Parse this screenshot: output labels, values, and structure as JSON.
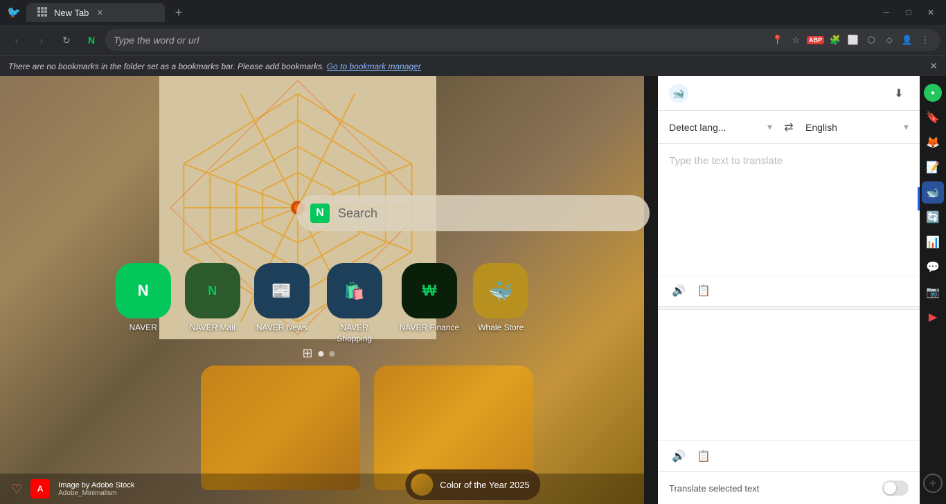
{
  "browser": {
    "title_bar": {
      "tab_label": "New Tab",
      "new_tab_icon": "+",
      "minimize": "─",
      "maximize": "□",
      "close": "✕",
      "apps_grid": "⊞"
    },
    "nav_bar": {
      "back": "‹",
      "forward": "›",
      "refresh": "↻",
      "n_icon": "N",
      "address": "Type the word or url",
      "location_icon": "⊕",
      "star_icon": "☆",
      "abp_label": "ABP",
      "extensions_icon": "⋮",
      "screenshot_icon": "⬡",
      "menu_icon": "≡",
      "profile_icon": "👤"
    },
    "bookmark_bar": {
      "message": "There are no bookmarks in the folder set as a bookmarks bar. Please add bookmarks.",
      "link_text": "Go to bookmark manager",
      "close": "✕"
    }
  },
  "new_tab": {
    "search": {
      "placeholder": "Search",
      "n_logo": "N"
    },
    "apps": [
      {
        "id": "naver",
        "label": "NAVER",
        "bg_color": "#03c75a"
      },
      {
        "id": "naver-mail",
        "label": "NAVER Mail",
        "bg_color": "#2d6a2d"
      },
      {
        "id": "naver-news",
        "label": "NAVER News",
        "bg_color": "#1e3f5a"
      },
      {
        "id": "naver-shopping",
        "label": "NAVER Shopping",
        "bg_color": "#1e3f5a"
      },
      {
        "id": "naver-finance",
        "label": "NAVER Finance",
        "bg_color": "#0d2b0d"
      },
      {
        "id": "whale-store",
        "label": "Whale Store",
        "bg_color": "#b89020"
      }
    ],
    "bottom_bar": {
      "image_by": "Image by Adobe Stock",
      "collection": "Adobe_Minimalism"
    },
    "color_year": {
      "label": "Color of the Year 2025"
    }
  },
  "translate_panel": {
    "source_lang": "Detect lang...",
    "target_lang": "English",
    "placeholder": "Type the text to translate",
    "footer_label": "Translate selected text"
  },
  "right_bar": {
    "icons": [
      {
        "id": "green-circle",
        "color": "#22c55e"
      },
      {
        "id": "bookmarks",
        "color": "#3b82f6"
      },
      {
        "id": "pocket",
        "color": "#ef4444"
      },
      {
        "id": "notes",
        "color": "#f59e0b"
      },
      {
        "id": "translate",
        "color": "#3b82f6",
        "active": true
      },
      {
        "id": "whale-sync",
        "color": "#22c55e"
      },
      {
        "id": "chart",
        "color": "#8b5cf6"
      },
      {
        "id": "chat",
        "color": "#22c55e"
      },
      {
        "id": "instagram",
        "color": "#e1306c"
      },
      {
        "id": "youtube",
        "color": "#ef4444"
      }
    ]
  }
}
